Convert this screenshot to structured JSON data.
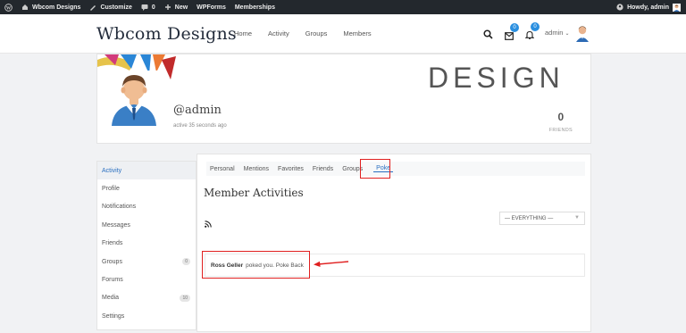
{
  "adminbar": {
    "site_name": "Wbcom Designs",
    "customize": "Customize",
    "comments_count": "0",
    "new_label": "New",
    "wpforms": "WPForms",
    "memberships": "Memberships",
    "howdy": "Howdy, admin"
  },
  "header": {
    "logo": "Wbcom Designs",
    "nav": [
      "Home",
      "Activity",
      "Groups",
      "Members"
    ],
    "messages_badge": "0",
    "notifications_badge": "0",
    "user_menu": "admin"
  },
  "profile": {
    "cover_text": "DESIGN",
    "username": "@admin",
    "active_status": "active 35 seconds ago",
    "friends_count": "0",
    "friends_label": "FRIENDS"
  },
  "sidebar": {
    "items": [
      {
        "label": "Activity",
        "count": ""
      },
      {
        "label": "Profile",
        "count": ""
      },
      {
        "label": "Notifications",
        "count": ""
      },
      {
        "label": "Messages",
        "count": ""
      },
      {
        "label": "Friends",
        "count": ""
      },
      {
        "label": "Groups",
        "count": "0"
      },
      {
        "label": "Forums",
        "count": ""
      },
      {
        "label": "Media",
        "count": "10"
      },
      {
        "label": "Settings",
        "count": ""
      }
    ]
  },
  "subnav": {
    "tabs": [
      "Personal",
      "Mentions",
      "Favorites",
      "Friends",
      "Groups",
      "Poke"
    ]
  },
  "main": {
    "title": "Member Activities",
    "filter_value": "— EVERYTHING —",
    "activity_user": "Ross Geller",
    "activity_text": "poked you. Poke Back"
  },
  "colors": {
    "accent": "#2a6fc0",
    "highlight_box": "#e02020",
    "adminbar_bg": "#23282d"
  }
}
